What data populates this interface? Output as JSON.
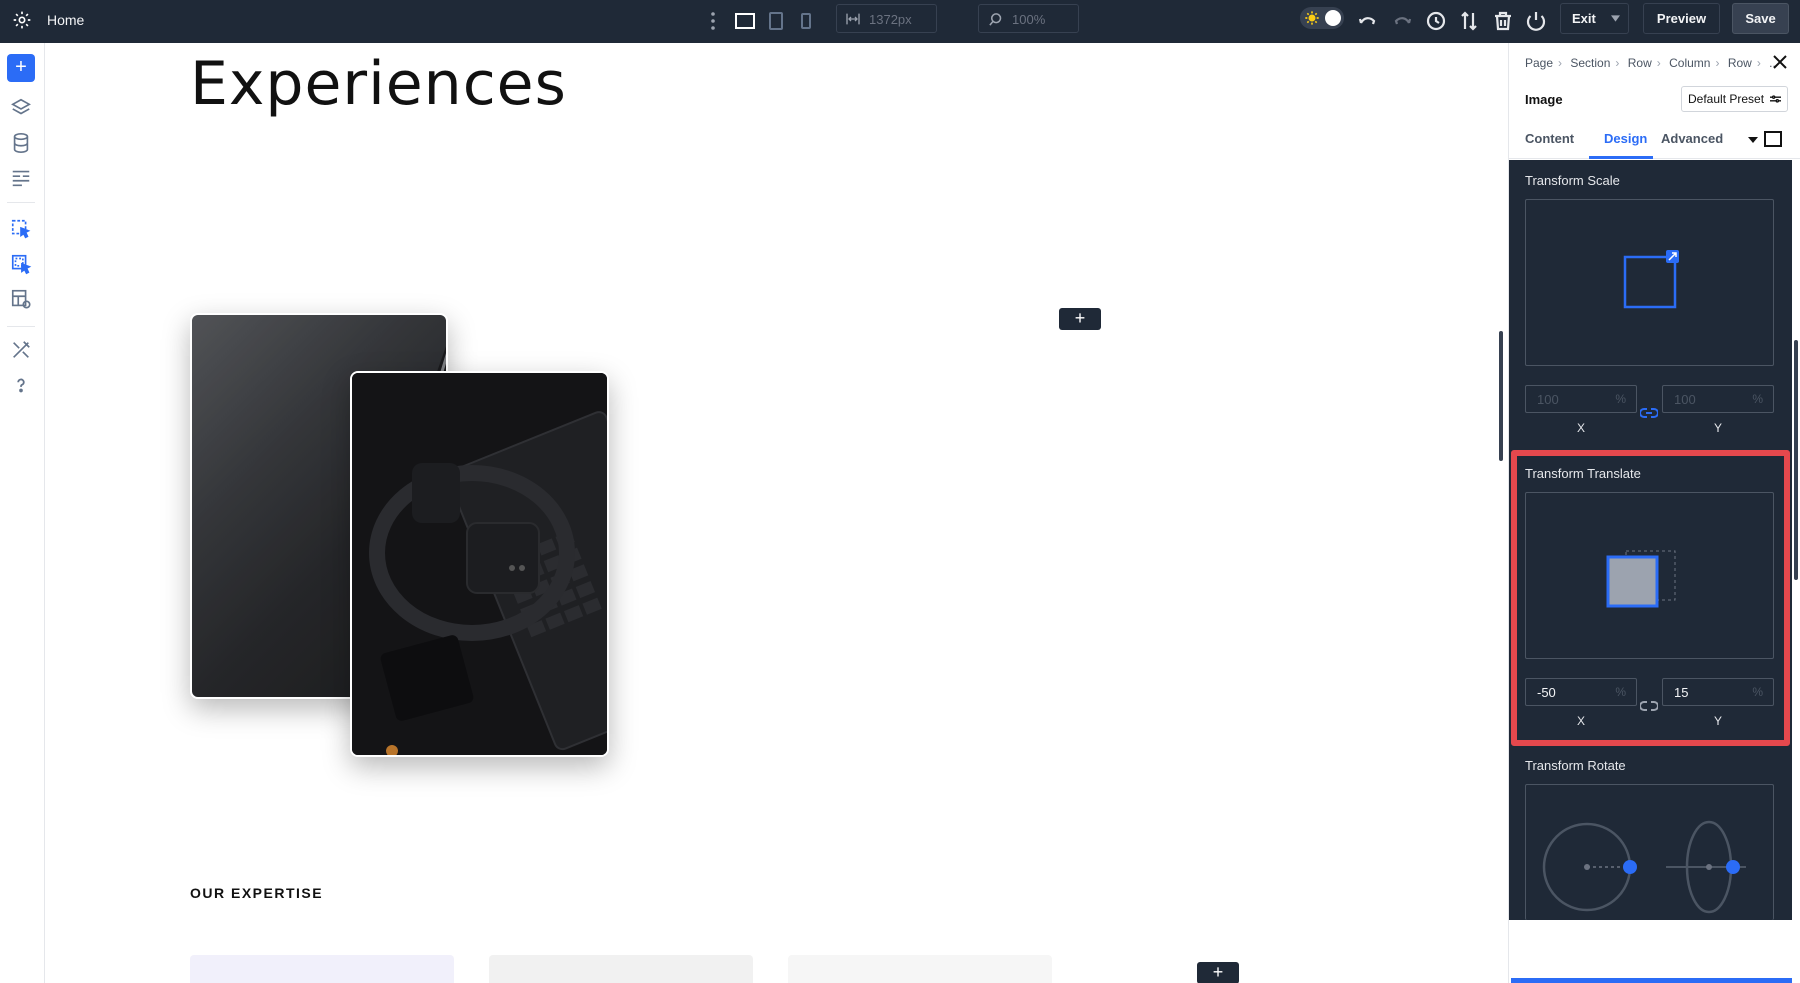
{
  "topbar": {
    "page_name": "Home",
    "width_value": "1372px",
    "zoom_value": "100%",
    "exit_label": "Exit",
    "preview_label": "Preview",
    "save_label": "Save"
  },
  "canvas": {
    "title": "Experiences",
    "section_label": "OUR EXPERTISE",
    "add_icon": "+"
  },
  "panel": {
    "breadcrumb": [
      "Page",
      "Section",
      "Row",
      "Column",
      "Row",
      ".."
    ],
    "element_name": "Image",
    "preset_label": "Default Preset",
    "tabs": [
      "Content",
      "Design",
      "Advanced"
    ],
    "active_tab": "Design",
    "transform_scale": {
      "title": "Transform Scale",
      "x": "100",
      "y": "100",
      "unit": "%",
      "x_label": "X",
      "y_label": "Y"
    },
    "transform_translate": {
      "title": "Transform Translate",
      "x": "-50",
      "y": "15",
      "unit": "%",
      "x_label": "X",
      "y_label": "Y"
    },
    "transform_rotate": {
      "title": "Transform Rotate"
    }
  },
  "colors": {
    "accent": "#2b6cf6",
    "topbar_bg": "#1f2937",
    "highlight": "#e5484d"
  }
}
